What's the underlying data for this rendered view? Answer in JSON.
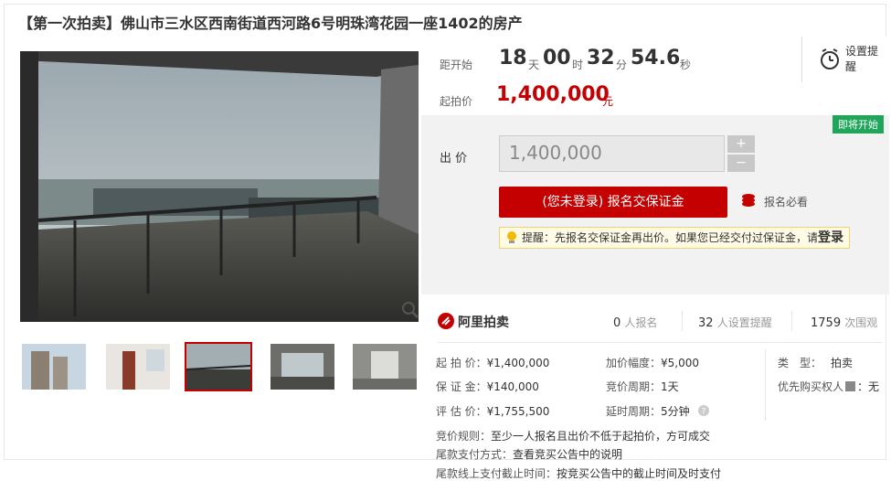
{
  "title": "【第一次拍卖】佛山市三水区西南街道西河路6号明珠湾花园一座1402的房产",
  "countdown": {
    "label": "距开始",
    "days": "18",
    "days_unit": "天",
    "hours": "00",
    "hours_unit": "时",
    "minutes": "32",
    "minutes_unit": "分",
    "seconds": "54.6",
    "seconds_unit": "秒"
  },
  "start_price": {
    "label": "起拍价",
    "value": "1,400,000",
    "unit": "元"
  },
  "reminder": {
    "label": "设置提醒",
    "icon": "alarm-clock-icon"
  },
  "status_badge": "即将开始",
  "bid": {
    "label": "出 价",
    "value": "1,400,000",
    "plus": "+",
    "minus": "−",
    "signup_button": "(您未登录) 报名交保证金",
    "must_read": "报名必看",
    "tip_text": "提醒：先报名交保证金再出价。如果您已经交付过保证金，请",
    "tip_login": "登录"
  },
  "platform": {
    "name": "阿里拍卖",
    "stats": [
      {
        "num": "0",
        "label": "人报名"
      },
      {
        "num": "32",
        "label": "人设置提醒"
      },
      {
        "num": "1759",
        "label": "次围观"
      }
    ]
  },
  "details": {
    "start_price": {
      "label": "起 拍 价：",
      "value": "¥1,400,000"
    },
    "deposit": {
      "label": "保 证 金：",
      "value": "¥140,000"
    },
    "appraisal": {
      "label": "评 估 价：",
      "value": "¥1,755,500"
    },
    "increment": {
      "label": "加价幅度：",
      "value": "¥5,000"
    },
    "period": {
      "label": "竞价周期：",
      "value": "1天"
    },
    "delay": {
      "label": "延时周期：",
      "value": "5分钟"
    },
    "type": {
      "label": "类　型：",
      "value": "拍卖"
    },
    "priority": {
      "label": "优先购买权人",
      "value": "：无"
    }
  },
  "rules": [
    {
      "label": "竞价规则：",
      "value": "至少一人报名且出价不低于起拍价，方可成交"
    },
    {
      "label": "尾款支付方式：",
      "value": "查看竞买公告中的说明"
    },
    {
      "label": "尾款线上支付截止时间：",
      "value": "按竞买公告中的截止时间及时支付"
    }
  ],
  "colors": {
    "accent": "#c40000",
    "badge": "#1fa65a"
  }
}
